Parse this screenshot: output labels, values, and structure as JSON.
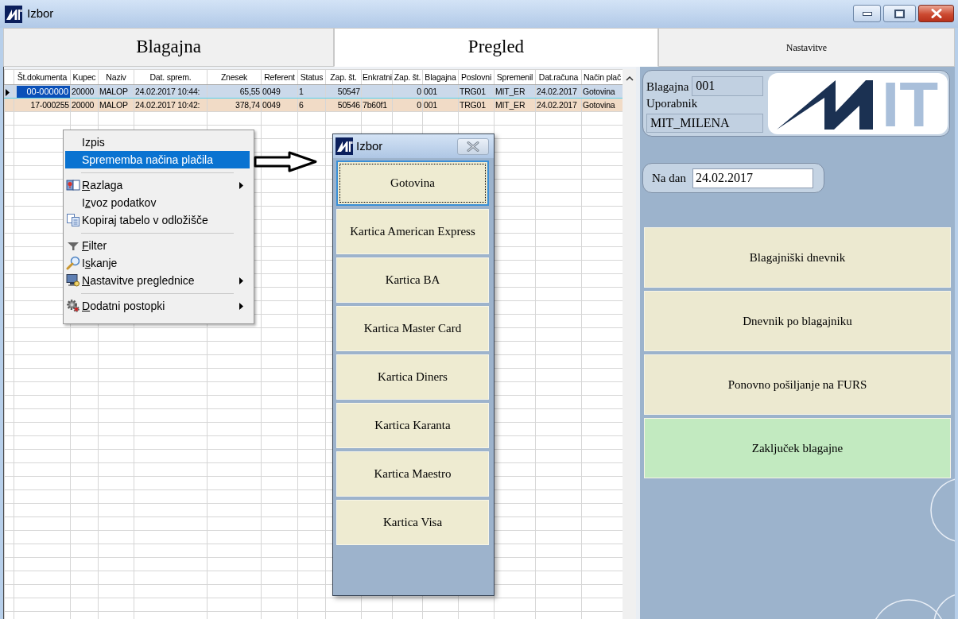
{
  "window": {
    "title": "Izbor"
  },
  "tabs": [
    {
      "label": "Blagajna",
      "selected": false
    },
    {
      "label": "Pregled",
      "selected": true
    },
    {
      "label": "Nastavitve",
      "selected": false
    }
  ],
  "table": {
    "columns": [
      {
        "label": "Št.dokumenta"
      },
      {
        "label": "Kupec"
      },
      {
        "label": "Naziv"
      },
      {
        "label": "Dat. sprem."
      },
      {
        "label": "Znesek"
      },
      {
        "label": "Referent"
      },
      {
        "label": "Status"
      },
      {
        "label": "Zap. št."
      },
      {
        "label": "Enkratni"
      },
      {
        "label": "Zap. št."
      },
      {
        "label": "Blagajna"
      },
      {
        "label": "Poslovni"
      },
      {
        "label": "Spremenil"
      },
      {
        "label": "Dat.računa"
      },
      {
        "label": "Način plač"
      }
    ],
    "rows": [
      {
        "selected": true,
        "cells": [
          "00-000000",
          "20000",
          "MALOP",
          "24.02.2017 10:44:",
          "65,55",
          "0049",
          "1",
          "50547",
          null,
          "0",
          "001",
          "TRG01",
          "MIT_ER",
          "24.02.2017",
          "Gotovina"
        ]
      },
      {
        "selected": false,
        "cells": [
          "17-000255",
          "20000",
          "MALOP",
          "24.02.2017 10:42:",
          "378,74",
          "0049",
          "6",
          "50546",
          "7b60f1",
          "0",
          "001",
          "TRG01",
          "MIT_ER",
          "24.02.2017",
          "Gotovina"
        ]
      }
    ]
  },
  "context_menu": {
    "items": [
      {
        "kind": "plain",
        "label": "Izpis",
        "selected": false,
        "submenu": false
      },
      {
        "kind": "plain",
        "label": "Sprememba načina plačila",
        "selected": true,
        "submenu": false
      },
      {
        "kind": "separator"
      },
      {
        "kind": "help",
        "access_key": "R",
        "label_end": "azlaga",
        "selected": false,
        "submenu": true
      },
      {
        "kind": "plain",
        "label_start": "I",
        "access_key": "z",
        "label_end": "voz podatkov",
        "selected": false,
        "submenu": false
      },
      {
        "kind": "copy",
        "label": "Kopiraj tabelo v odložišče",
        "selected": false,
        "submenu": false
      },
      {
        "kind": "separator"
      },
      {
        "kind": "filter",
        "access_key": "F",
        "label_end": "ilter",
        "selected": false,
        "submenu": false
      },
      {
        "kind": "search",
        "label_start": "I",
        "access_key": "s",
        "label_end": "kanje",
        "selected": false,
        "submenu": false
      },
      {
        "kind": "settings",
        "access_key": "N",
        "label_end": "astavitve preglednice",
        "selected": false,
        "submenu": true
      },
      {
        "kind": "separator"
      },
      {
        "kind": "tools",
        "access_key": "D",
        "label_end": "odatni postopki",
        "selected": false,
        "submenu": true
      }
    ]
  },
  "dialog": {
    "title": "Izbor",
    "options": [
      {
        "label": "Gotovina",
        "focused": true
      },
      {
        "label": "Kartica American Express",
        "focused": false
      },
      {
        "label": "Kartica BA",
        "focused": false
      },
      {
        "label": "Kartica Master Card",
        "focused": false
      },
      {
        "label": "Kartica Diners",
        "focused": false
      },
      {
        "label": "Kartica Karanta",
        "focused": false
      },
      {
        "label": "Kartica Maestro",
        "focused": false
      },
      {
        "label": "Kartica Visa",
        "focused": false
      }
    ]
  },
  "side_panel": {
    "register_label": "Blagajna",
    "register": "001",
    "user_label": "Uporabnik",
    "user": "MIT_MILENA",
    "logo_text": "IT",
    "date_label": "Na dan",
    "date": "24.02.2017",
    "buttons": [
      {
        "label": "Blagajniški dnevnik",
        "color": "#ece9d0"
      },
      {
        "label": "Dnevnik po blagajniku",
        "color": "#ece9d0"
      },
      {
        "label": "Ponovno pošiljanje na FURS",
        "color": "#ece9d0"
      },
      {
        "label": "Zaključek blagajne",
        "color": "#c2eac0"
      }
    ]
  }
}
